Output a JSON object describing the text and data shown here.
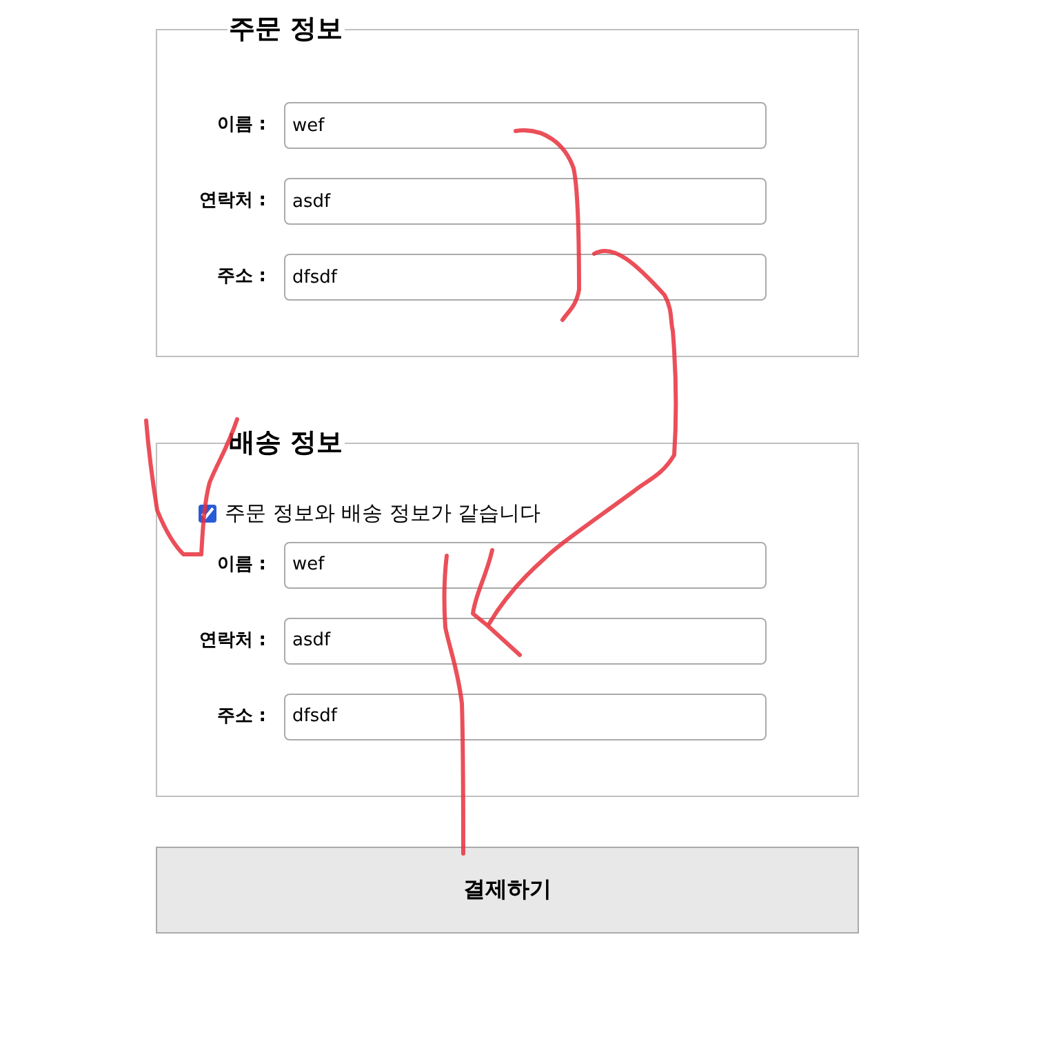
{
  "sections": [
    {
      "title": "주문 정보",
      "fields": [
        {
          "label": "이름 :",
          "value": "wef"
        },
        {
          "label": "연락처 :",
          "value": "asdf"
        },
        {
          "label": "주소 :",
          "value": "dfsdf"
        }
      ]
    },
    {
      "title": "배송 정보",
      "same_as_order": {
        "label": "주문 정보와 배송 정보가 같습니다",
        "checked": true
      },
      "fields": [
        {
          "label": "이름 :",
          "value": "wef"
        },
        {
          "label": "연락처 :",
          "value": "asdf"
        },
        {
          "label": "주소 :",
          "value": "dfsdf"
        }
      ]
    }
  ],
  "submit_button": "결제하기"
}
